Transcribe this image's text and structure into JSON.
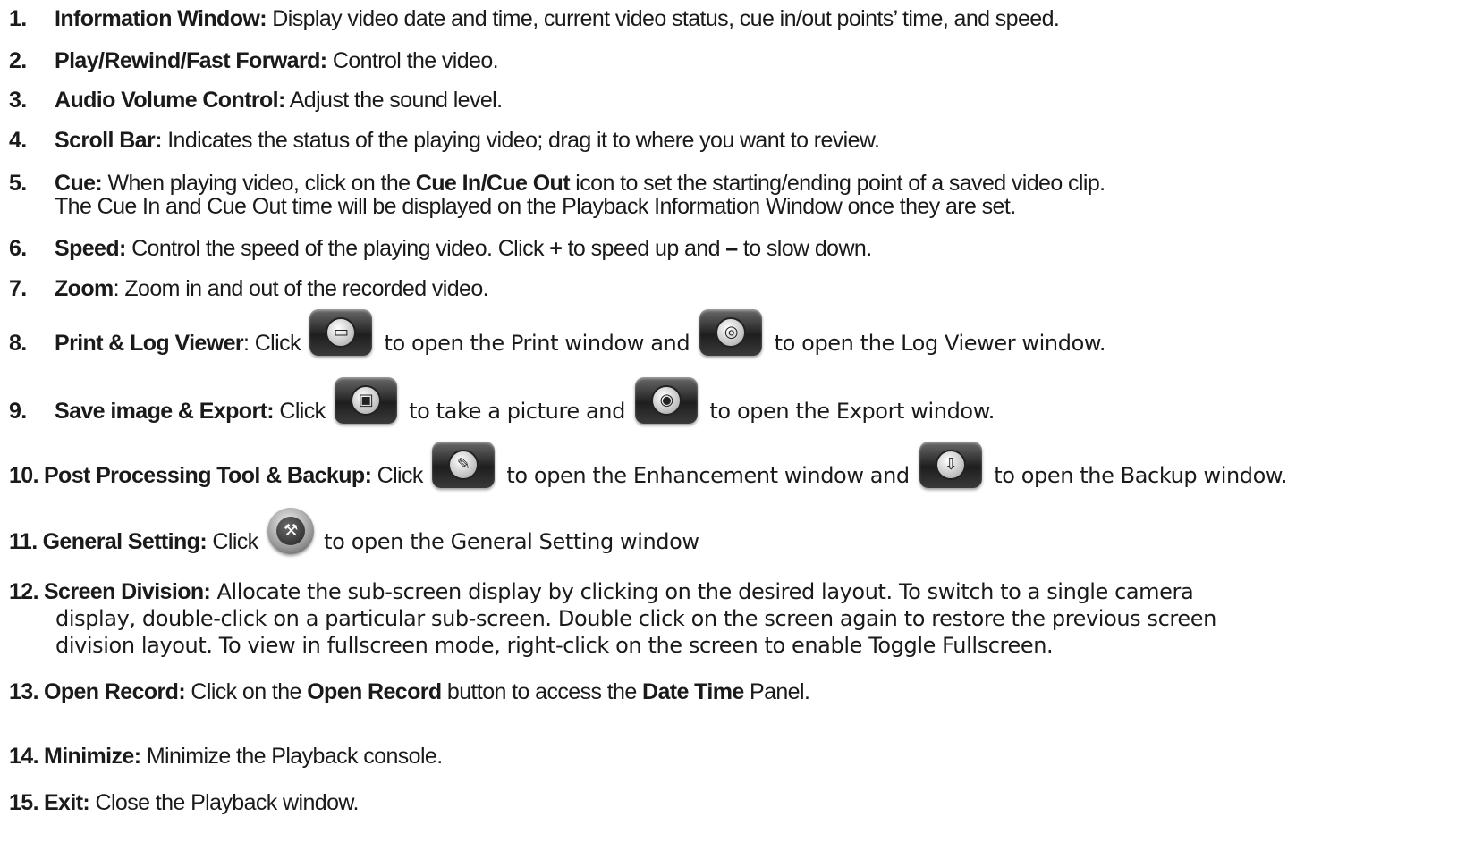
{
  "items": [
    {
      "num": "1.",
      "term": "Information Window:",
      "text": " Display video date and time, current video status, cue in/out points’ time, and speed."
    },
    {
      "num": "2.",
      "term": "Play/Rewind/Fast Forward:",
      "text": " Control the video."
    },
    {
      "num": "3.",
      "term": "Audio Volume Control:",
      "text": " Adjust the sound level."
    },
    {
      "num": "4.",
      "term": "Scroll Bar:",
      "text": " Indicates the status of the playing video; drag it to where you want to review."
    },
    {
      "num": "5.",
      "term": "Cue:",
      "text_a": " When playing video, click on the ",
      "bold": "Cue In/Cue Out",
      "text_b": " icon to set the starting/ending point of a saved video clip.",
      "line2": "The Cue In and Cue Out time will be displayed on the Playback Information Window once they are set."
    },
    {
      "num": "6.",
      "term": "Speed:",
      "text_a": " Control the speed of the playing video. Click ",
      "plus": "+",
      "text_b": " to speed up and ",
      "minus": "–",
      "text_c": " to slow down."
    },
    {
      "num": "7.",
      "term": "Zoom",
      "text": ": Zoom in and out of the recorded video."
    },
    {
      "num": "8.",
      "term": "Print & Log Viewer",
      "text_a": ": Click ",
      "icon1": "print-icon",
      "text_b": " to open the Print window and ",
      "icon2": "log-viewer-icon",
      "text_c": " to open the Log Viewer window."
    },
    {
      "num": "9.",
      "term": "Save image & Export:",
      "text_a": " Click ",
      "icon1": "save-image-icon",
      "text_b": " to take a picture and ",
      "icon2": "export-icon",
      "text_c": " to open the Export window."
    },
    {
      "num": "10.",
      "term": "Post Processing Tool & Backup:",
      "text_a": " Click ",
      "icon1": "enhancement-icon",
      "text_b": " to open the Enhancement window and ",
      "icon2": "backup-icon",
      "text_c": " to open the Backup window."
    },
    {
      "num": "11.",
      "term": "General Setting:",
      "text_a": " Click ",
      "icon1": "wrench-icon",
      "text_b": " to open the General Setting window"
    },
    {
      "num": "12.",
      "term": "Screen Division:",
      "text": " Allocate the sub-screen display by clicking on the desired layout. To switch to a single camera",
      "line2": "display, double-click on a particular sub-screen. Double click on the screen again to restore the previous screen",
      "line3": "division layout. To view in fullscreen mode, right-click on the screen to enable Toggle Fullscreen."
    },
    {
      "num": "13.",
      "term": "Open Record:",
      "text_a": " Click on the ",
      "bold1": "Open Record",
      "text_b": " button to access the ",
      "bold2": "Date Time",
      "text_c": " Panel."
    },
    {
      "num": "14.",
      "term": "Minimize:",
      "text": " Minimize the Playback console."
    },
    {
      "num": "15.",
      "term": "Exit:",
      "text": " Close the Playback window."
    }
  ]
}
